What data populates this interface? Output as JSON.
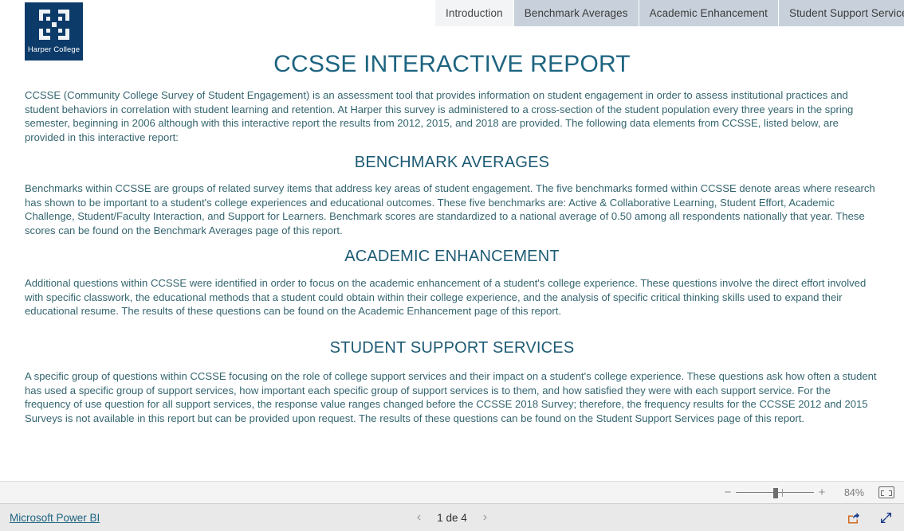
{
  "logo": {
    "name": "Harper College",
    "mark": "harper-blocks-logo",
    "bg_color": "#0c3b6a"
  },
  "tabs": [
    {
      "label": "Introduction",
      "active": true
    },
    {
      "label": "Benchmark Averages",
      "active": false
    },
    {
      "label": "Academic Enhancement",
      "active": false
    },
    {
      "label": "Student Support Services",
      "active": false
    }
  ],
  "report": {
    "title": "CCSSE INTERACTIVE REPORT",
    "title_color": "#1d6480",
    "intro_paragraph": "CCSSE (Community College Survey of Student Engagement) is an assessment tool that provides information on student engagement in order to assess institutional practices and student behaviors in correlation with student learning and retention. At Harper this survey is administered to a cross-section of the student population every three years in the spring semester, beginning in 2006 although with this interactive report the results from 2012, 2015, and 2018 are provided. The following data elements from CCSSE, listed below, are provided in this interactive report:",
    "sections": [
      {
        "heading": "BENCHMARK AVERAGES",
        "paragraph": "Benchmarks within CCSSE are groups of related survey items that address key areas of student engagement. The five benchmarks formed within CCSSE denote areas where research has shown to be important to a student's college experiences and educational outcomes. These five benchmarks are: Active & Collaborative Learning, Student Effort, Academic Challenge, Student/Faculty Interaction, and Support for Learners. Benchmark scores are standardized to a national average of 0.50 among all respondents nationally that year. These scores can be found on the Benchmark Averages page of this report."
      },
      {
        "heading": "ACADEMIC ENHANCEMENT",
        "paragraph": "Additional questions within CCSSE were identified in order to focus on the academic enhancement of a student's college experience. These questions involve the direct effort involved with specific classwork, the educational methods that a student could obtain within their college experience, and the analysis of specific critical thinking skills used to expand their educational resume. The results of these questions can be found on the Academic Enhancement page of this report."
      },
      {
        "heading": "STUDENT SUPPORT SERVICES",
        "paragraph": "A specific group of questions within CCSSE focusing on the role of college support services and their impact on a student's college experience. These questions ask how often a student has used a specific group of support services, how important each specific group of support services is to them, and how satisfied they were with each support service. For the frequency of use question for all support services, the response value ranges changed before the CCSSE 2018 Survey; therefore, the frequency results for the CCSSE 2012 and 2015 Surveys is not available in this report but can be provided upon request. The results of these questions can be found on the Student Support Services page of this report."
      }
    ]
  },
  "zoom_bar": {
    "minus_label": "−",
    "plus_label": "+",
    "percent": "84%",
    "fit_icon": "fit-to-page-icon"
  },
  "footer": {
    "powerbi_link": "Microsoft Power BI",
    "prev_arrow": "‹",
    "page_label": "1 de 4",
    "next_arrow": "›",
    "share_icon": "share-icon",
    "fullscreen_icon": "fullscreen-icon"
  }
}
